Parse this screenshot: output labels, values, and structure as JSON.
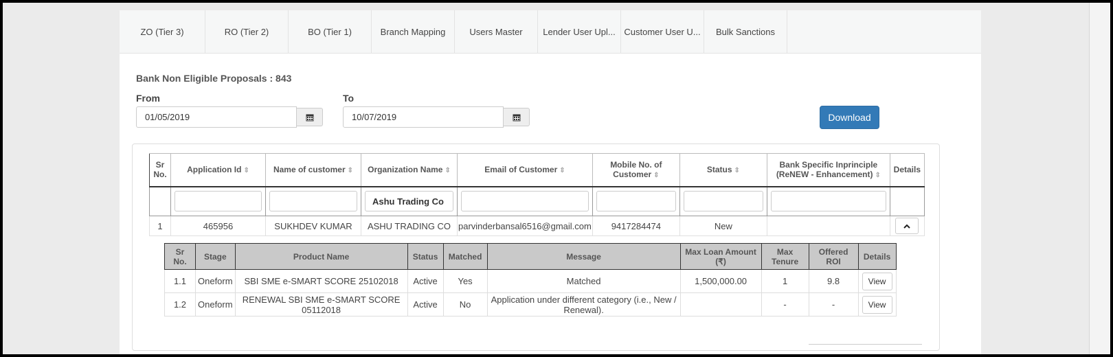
{
  "tabs": [
    {
      "label": "ZO (Tier 3)"
    },
    {
      "label": "RO (Tier 2)"
    },
    {
      "label": "BO (Tier 1)"
    },
    {
      "label": "Branch Mapping"
    },
    {
      "label": "Users Master"
    },
    {
      "label": "Lender User Upl..."
    },
    {
      "label": "Customer User U..."
    },
    {
      "label": "Bulk Sanctions"
    }
  ],
  "page": {
    "title": "Bank Non Eligible Proposals : 843",
    "from_label": "From",
    "to_label": "To",
    "from_value": "01/05/2019",
    "to_value": "10/07/2019",
    "download_label": "Download",
    "sort_glyph": "⇕"
  },
  "main_table": {
    "headers": {
      "sr": [
        "Sr",
        "No."
      ],
      "app_id": "Application Id",
      "name": "Name of customer",
      "org": "Organization Name",
      "email": "Email of Customer",
      "mobile": [
        "Mobile No. of",
        "Customer"
      ],
      "status": "Status",
      "inprinciple": [
        "Bank Specific Inprinciple",
        "(ReNEW - Enhancement)"
      ],
      "details": "Details"
    },
    "filters": {
      "org": "Ashu Trading Co"
    },
    "row": {
      "sr": "1",
      "app_id": "465956",
      "name": "SUKHDEV KUMAR",
      "org": "ASHU TRADING CO",
      "email": "parvinderbansal6516@gmail.com",
      "mobile": "9417284474",
      "status": "New",
      "inprinciple": ""
    }
  },
  "sub_table": {
    "headers": {
      "sr": [
        "Sr",
        "No."
      ],
      "stage": "Stage",
      "product": "Product Name",
      "status": "Status",
      "matched": "Matched",
      "message": "Message",
      "max_loan": [
        "Max Loan Amount",
        "(₹)"
      ],
      "max_tenure": [
        "Max",
        "Tenure"
      ],
      "roi": [
        "Offered",
        "ROI"
      ],
      "details": "Details"
    },
    "rows": [
      {
        "sr": "1.1",
        "stage": "Oneform",
        "product": "SBI SME e-SMART SCORE 25102018",
        "status": "Active",
        "matched": "Yes",
        "message": "Matched",
        "max_loan": "1,500,000.00",
        "max_tenure": "1",
        "roi": "9.8",
        "view": "View"
      },
      {
        "sr": "1.2",
        "stage": "Oneform",
        "product": "RENEWAL SBI SME e-SMART SCORE 05112018",
        "status": "Active",
        "matched": "No",
        "message": "Application under different category (i.e., New / Renewal).",
        "max_loan": "",
        "max_tenure": "-",
        "roi": "-",
        "view": "View"
      }
    ]
  },
  "icons": {
    "calendar": "calendar-icon",
    "chevron": "chevron-up-icon"
  }
}
